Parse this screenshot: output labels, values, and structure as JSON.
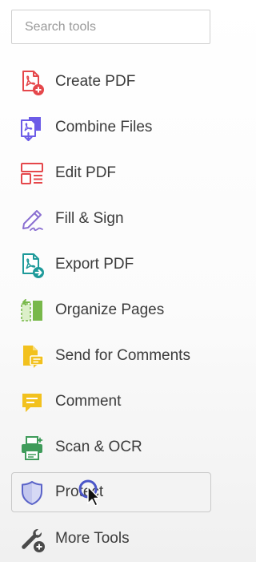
{
  "search": {
    "placeholder": "Search tools"
  },
  "tools": [
    {
      "label": "Create PDF",
      "icon": "create-pdf-icon",
      "color": "#e5474b"
    },
    {
      "label": "Combine Files",
      "icon": "combine-files-icon",
      "color": "#6c5ce7"
    },
    {
      "label": "Edit PDF",
      "icon": "edit-pdf-icon",
      "color": "#e5474b"
    },
    {
      "label": "Fill & Sign",
      "icon": "fill-sign-icon",
      "color": "#8a6fd1"
    },
    {
      "label": "Export PDF",
      "icon": "export-pdf-icon",
      "color": "#1e9a9a"
    },
    {
      "label": "Organize Pages",
      "icon": "organize-pages-icon",
      "color": "#78b84a"
    },
    {
      "label": "Send for Comments",
      "icon": "send-for-comments-icon",
      "color": "#f2c11e"
    },
    {
      "label": "Comment",
      "icon": "comment-icon",
      "color": "#f2c11e"
    },
    {
      "label": "Scan & OCR",
      "icon": "scan-ocr-icon",
      "color": "#3f9b5a"
    },
    {
      "label": "Protect",
      "icon": "protect-icon",
      "color": "#5a63c8",
      "active": true
    },
    {
      "label": "More Tools",
      "icon": "more-tools-icon",
      "color": "#4a4a4a"
    }
  ]
}
